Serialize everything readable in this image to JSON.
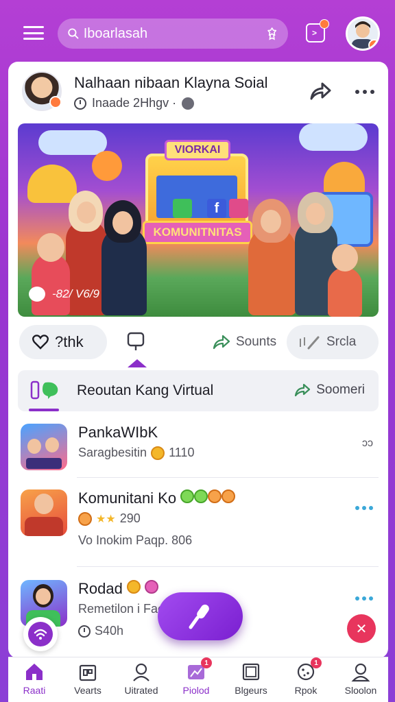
{
  "topbar": {
    "search_value": "Iboarlasah",
    "notifications_badge": "1"
  },
  "post": {
    "title": "Nalhaan nibaan Klayna Soial",
    "meta": "Inaade 2Hhgv ·",
    "banner_top": "VIORKAI",
    "banner_bottom": "KOMUNITNITAS",
    "banner_fb": "f",
    "banner_stats": "-82/ V6/9"
  },
  "actions": {
    "like": "?thk",
    "share": "Sounts",
    "save": "Srcla"
  },
  "section": {
    "title": "Reoutan Kang Virtual",
    "action": "Soomeri"
  },
  "communities": [
    {
      "name": "PankaWIbK",
      "sub": "Saragbesitin",
      "sub_count": "1110",
      "right": "ɔɔ"
    },
    {
      "name": "Komunitani Ko",
      "sub": "290",
      "sub2": "Vo Inokim Paqp. 806"
    },
    {
      "name": "Rodad",
      "sub": "Remetilon i Faek",
      "sub2": "S40h"
    }
  ],
  "nav": [
    {
      "label": "Raati",
      "icon": "home-icon"
    },
    {
      "label": "Vearts",
      "icon": "shop-icon"
    },
    {
      "label": "Uitrated",
      "icon": "profile-icon"
    },
    {
      "label": "Piolod",
      "icon": "media-icon",
      "badge": "1"
    },
    {
      "label": "Blgeurs",
      "icon": "grid-icon"
    },
    {
      "label": "Rpok",
      "icon": "cookie-icon",
      "badge": "1"
    },
    {
      "label": "Sloolon",
      "icon": "user-icon"
    }
  ],
  "colors": {
    "accent": "#8b2fc9",
    "brand_gradient_top": "#b43fd4",
    "badge": "#ff7a3d",
    "alert": "#e8355d"
  }
}
